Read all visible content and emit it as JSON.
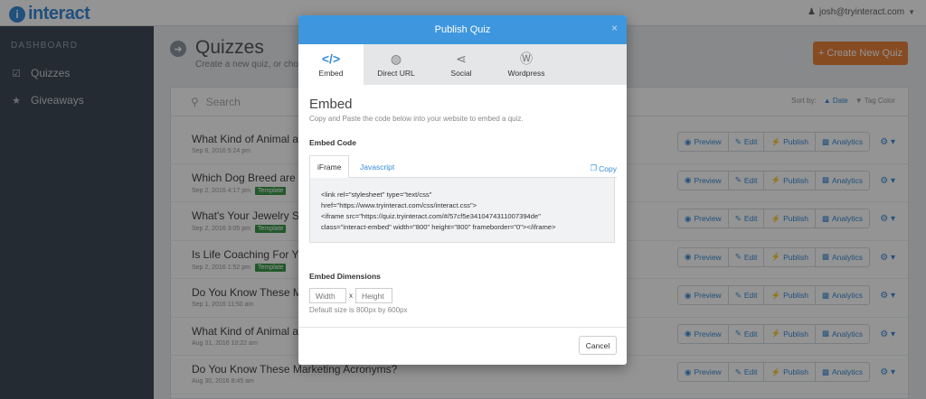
{
  "app": {
    "logo_mark": "i",
    "logo_text": "interact",
    "user_email": "josh@tryinteract.com"
  },
  "sidebar": {
    "heading": "DASHBOARD",
    "items": [
      {
        "label": "Quizzes",
        "icon": "checkbox-icon"
      },
      {
        "label": "Giveaways",
        "icon": "trophy-icon"
      }
    ]
  },
  "main": {
    "title": "Quizzes",
    "subtitle": "Create a new quiz, or choo",
    "create_button": "Create New Quiz",
    "search_placeholder": "Search",
    "sort": {
      "label": "Sort by:",
      "options": [
        "Date",
        "Tag Color"
      ],
      "active": "Date"
    },
    "quizzes": [
      {
        "title": "What Kind of Animal ar",
        "date": "Sep 6, 2016 5:24 pm",
        "template": ""
      },
      {
        "title": "Which Dog Breed are Y",
        "date": "Sep 2, 2016 4:17 pm",
        "template": "Template"
      },
      {
        "title": "What's Your Jewelry St",
        "date": "Sep 2, 2016 3:05 pm",
        "template": "Template"
      },
      {
        "title": "Is Life Coaching For Yo",
        "date": "Sep 2, 2016 1:52 pm",
        "template": "Template"
      },
      {
        "title": "Do You Know These M",
        "date": "Sep 1, 2016 11:50 am",
        "template": ""
      },
      {
        "title": "What Kind of Animal ar",
        "date": "Aug 31, 2016 10:22 am",
        "template": ""
      },
      {
        "title": "Do You Know These Marketing Acronyms?",
        "date": "Aug 30, 2016 8:45 am",
        "template": ""
      }
    ],
    "row_actions": [
      "Preview",
      "Edit",
      "Publish",
      "Analytics"
    ]
  },
  "modal": {
    "title": "Publish Quiz",
    "close": "×",
    "tabs": [
      {
        "label": "Embed",
        "icon": "code-icon",
        "glyph": "</>"
      },
      {
        "label": "Direct URL",
        "icon": "globe-icon",
        "glyph": "◍"
      },
      {
        "label": "Social",
        "icon": "share-icon",
        "glyph": "⋖"
      },
      {
        "label": "Wordpress",
        "icon": "wordpress-icon",
        "glyph": "Ⓦ"
      }
    ],
    "active_tab": "Embed",
    "heading": "Embed",
    "description": "Copy and Paste the code below into your website to embed a quiz.",
    "embed_code_label": "Embed Code",
    "code_tabs": [
      "iFrame",
      "Javascript"
    ],
    "copy_label": "Copy",
    "code_lines": [
      "<link rel=\"stylesheet\" type=\"text/css\"",
      "href=\"https://www.tryinteract.com/css/interact.css\">",
      "<iframe src=\"https://quiz.tryinteract.com/#/57cf5e3410474311007394de\"",
      "class=\"interact-embed\" width=\"800\" height=\"800\" frameborder=\"0\"></iframe>"
    ],
    "dimensions_label": "Embed Dimensions",
    "width_placeholder": "Width",
    "height_placeholder": "Height",
    "dims_separator": "x",
    "dims_hint": "Default size is 800px by 600px",
    "cancel_label": "Cancel"
  },
  "colors": {
    "brand_blue": "#3a8bd6",
    "modal_header": "#3e97de",
    "create_button": "#e8813b",
    "template_badge": "#3c9a4a",
    "sidebar": "#3e4a56"
  }
}
